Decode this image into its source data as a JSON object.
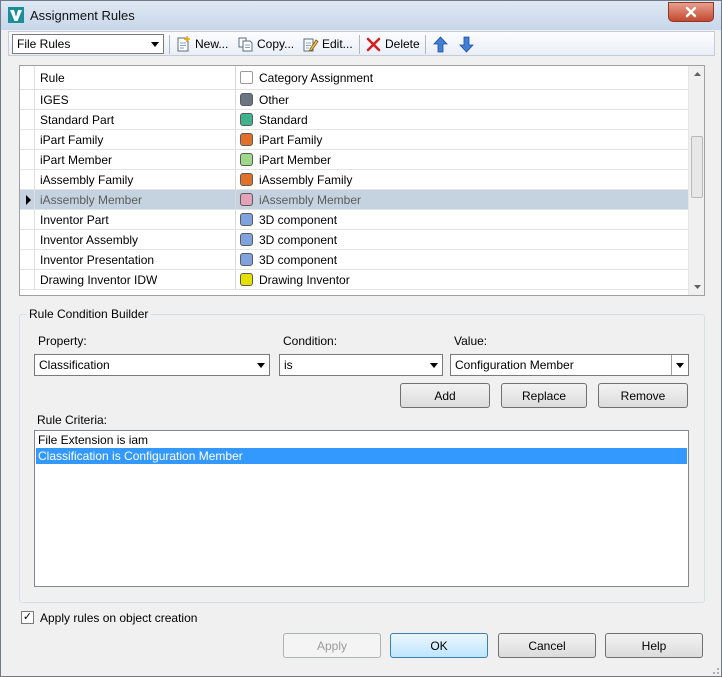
{
  "window": {
    "title": "Assignment Rules",
    "close_glyph": "✕"
  },
  "toolbar": {
    "rule_type": "File Rules",
    "new_label": "New...",
    "copy_label": "Copy...",
    "edit_label": "Edit...",
    "delete_label": "Delete"
  },
  "grid": {
    "columns": [
      "Rule",
      "Category Assignment"
    ],
    "selected_index": 5,
    "rows": [
      {
        "rule": "IGES",
        "category": "Other",
        "color": "#6c7585"
      },
      {
        "rule": "Standard Part",
        "category": "Standard",
        "color": "#3fb38c"
      },
      {
        "rule": "iPart Family",
        "category": "iPart Family",
        "color": "#e0702a"
      },
      {
        "rule": "iPart Member",
        "category": "iPart Member",
        "color": "#9ed98a"
      },
      {
        "rule": "iAssembly Family",
        "category": "iAssembly Family",
        "color": "#e0702a"
      },
      {
        "rule": "iAssembly Member",
        "category": "iAssembly Member",
        "color": "#e3a2b8"
      },
      {
        "rule": "Inventor Part",
        "category": "3D component",
        "color": "#7ea3df"
      },
      {
        "rule": "Inventor Assembly",
        "category": "3D component",
        "color": "#7ea3df"
      },
      {
        "rule": "Inventor Presentation",
        "category": "3D component",
        "color": "#7ea3df"
      },
      {
        "rule": "Drawing Inventor IDW",
        "category": "Drawing Inventor",
        "color": "#e5e000"
      }
    ]
  },
  "builder": {
    "group_title": "Rule Condition Builder",
    "property_label": "Property:",
    "property_value": "Classification",
    "condition_label": "Condition:",
    "condition_value": "is",
    "value_label": "Value:",
    "value_value": "Configuration Member",
    "add_label": "Add",
    "replace_label": "Replace",
    "remove_label": "Remove",
    "criteria_label": "Rule Criteria:",
    "criteria": [
      "File Extension is iam",
      "Classification is Configuration Member"
    ]
  },
  "footer": {
    "apply_on_creation_label": "Apply rules on object creation",
    "apply_on_creation_checked": true,
    "check_glyph": "✓",
    "apply_label": "Apply",
    "ok_label": "OK",
    "cancel_label": "Cancel",
    "help_label": "Help"
  }
}
